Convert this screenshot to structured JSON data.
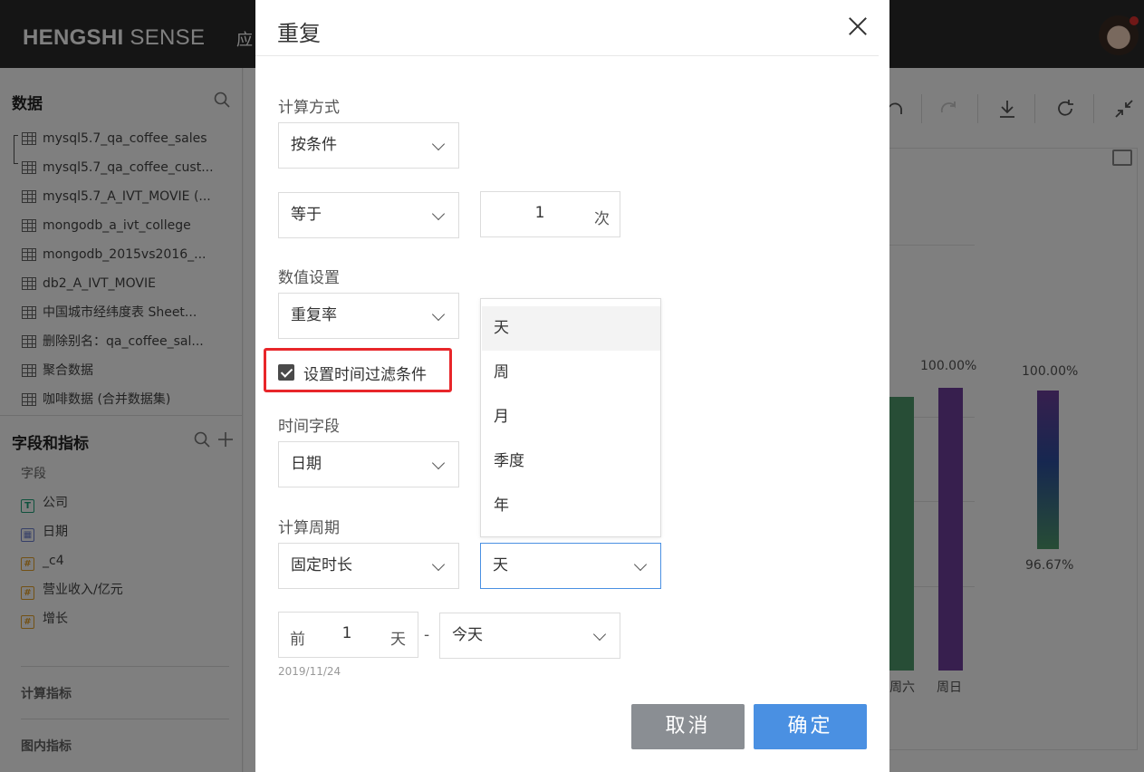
{
  "app": {
    "brand_bold": "HENGSHI",
    "brand_light": " SENSE",
    "nav_partial": "应"
  },
  "sidebar": {
    "data_title": "数据",
    "datasets": [
      "mysql5.7_qa_coffee_sales",
      "mysql5.7_qa_coffee_cust...",
      "mysql5.7_A_IVT_MOVIE (...",
      "mongodb_a_ivt_college",
      "mongodb_2015vs2016_...",
      "db2_A_IVT_MOVIE",
      "中国城市经纬度表 Sheet...",
      "删除别名：qa_coffee_sal...",
      "聚合数据",
      "咖啡数据 (合并数据集)"
    ],
    "fields_title": "字段和指标",
    "fields_sub": "字段",
    "fields": [
      {
        "type": "T",
        "name": "公司"
      },
      {
        "type": "date",
        "name": "日期"
      },
      {
        "type": "#",
        "name": "_c4"
      },
      {
        "type": "#",
        "name": "营业收入/亿元"
      },
      {
        "type": "#",
        "name": "增长"
      }
    ],
    "section_calc": "计算指标",
    "section_chart": "图内指标"
  },
  "chart_data": {
    "type": "bar",
    "categories": [
      "周六",
      "周日"
    ],
    "values": [
      null,
      100.0
    ],
    "value_labels": [
      "100.00%"
    ],
    "color_legend": {
      "max_label": "100.00%",
      "min_label": "96.67%"
    },
    "colors": {
      "saturday": "#4f9a6c",
      "sunday": "#6e3f9c"
    }
  },
  "dialog": {
    "title": "重复",
    "calc_method_label": "计算方式",
    "calc_method_value": "按条件",
    "operator_value": "等于",
    "count_value": "1",
    "count_unit": "次",
    "value_setting_label": "数值设置",
    "value_setting_value": "重复率",
    "time_filter_checkbox": "设置时间过滤条件",
    "time_filter_checked": true,
    "time_field_label": "时间字段",
    "time_field_value": "日期",
    "period_label": "计算周期",
    "period_type_value": "固定时长",
    "period_unit_value": "天",
    "period_unit_options": [
      "天",
      "周",
      "月",
      "季度",
      "年"
    ],
    "range_prefix": "前",
    "range_value": "1",
    "range_unit": "天",
    "range_dash": "-",
    "range_end_value": "今天",
    "date_hint": "2019/11/24",
    "cancel_label": "取消",
    "ok_label": "确定"
  }
}
